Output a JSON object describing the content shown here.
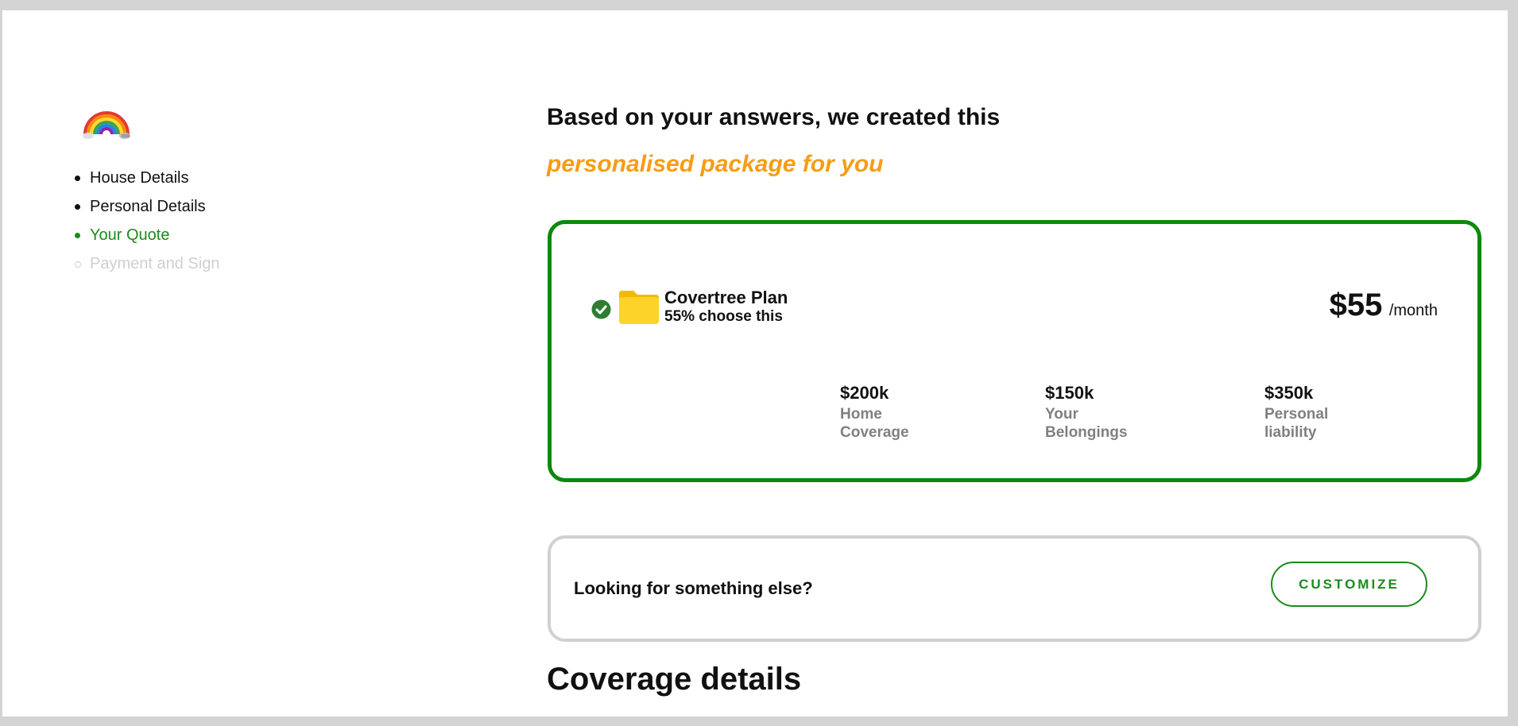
{
  "brand": {
    "logo_icon": "rainbow-icon"
  },
  "steps": [
    {
      "label": "House Details",
      "state": "done"
    },
    {
      "label": "Personal Details",
      "state": "done"
    },
    {
      "label": "Your Quote",
      "state": "active"
    },
    {
      "label": "Payment and Sign",
      "state": "pending"
    }
  ],
  "main": {
    "headline": "Based on your answers, we created this",
    "subheadline": "personalised package for you",
    "plan": {
      "status_icon": "check-circle-icon",
      "plan_icon": "folder-icon",
      "name": "Covertree Plan",
      "popularity": "55% choose this",
      "price": "$55",
      "price_unit": "/month",
      "stats": [
        {
          "value": "$200k",
          "label_line1": "Home",
          "label_line2": "Coverage"
        },
        {
          "value": "$150k",
          "label_line1": "Your",
          "label_line2": "Belongings"
        },
        {
          "value": "$350k",
          "label_line1": "Personal",
          "label_line2": "liability"
        }
      ]
    },
    "alternative": {
      "text": "Looking for something else?",
      "button_label": "CUSTOMIZE"
    },
    "section_heading": "Coverage details"
  },
  "colors": {
    "accent_green": "#0b8a0b",
    "highlight_orange": "#f59d14",
    "muted_gray": "#808080",
    "card_border_gray": "#d0d0d0"
  }
}
